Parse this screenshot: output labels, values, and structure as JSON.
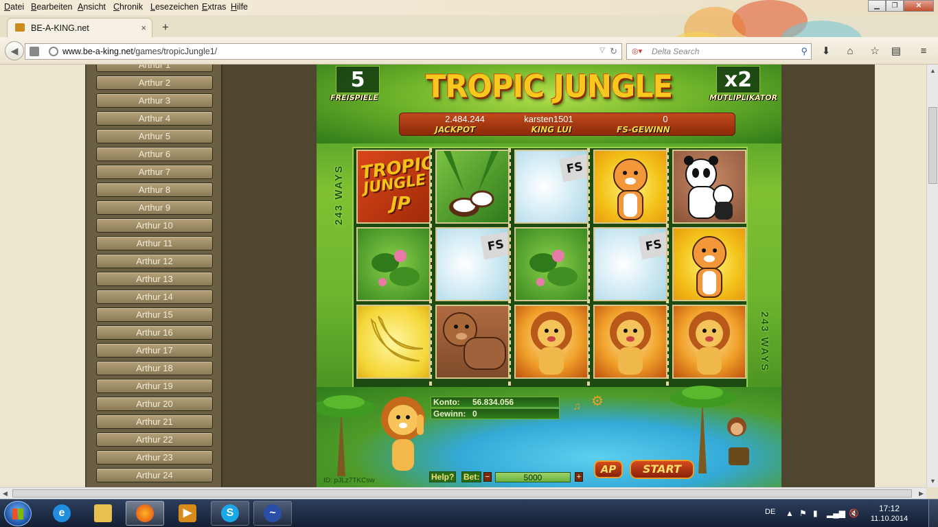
{
  "menu": [
    "Datei",
    "Bearbeiten",
    "Ansicht",
    "Chronik",
    "Lesezeichen",
    "Extras",
    "Hilfe"
  ],
  "tab": {
    "title": "BE-A-KING.net",
    "close": "×",
    "new": "+"
  },
  "address": {
    "url_host": "www.be-a-king.net",
    "url_path": "/games/tropicJungle1/"
  },
  "search": {
    "placeholder": "Delta Search"
  },
  "sidebar": {
    "items": [
      "Arthur 1",
      "Arthur 2",
      "Arthur 3",
      "Arthur 4",
      "Arthur 5",
      "Arthur 6",
      "Arthur 7",
      "Arthur 8",
      "Arthur 9",
      "Arthur 10",
      "Arthur 11",
      "Arthur 12",
      "Arthur 13",
      "Arthur 14",
      "Arthur 15",
      "Arthur 16",
      "Arthur 17",
      "Arthur 18",
      "Arthur 19",
      "Arthur 20",
      "Arthur 21",
      "Arthur 22",
      "Arthur 23",
      "Arthur 24"
    ]
  },
  "game": {
    "title": "TROPIC JUNGLE",
    "freespins_value": "5",
    "freespins_label": "FREISPIELE",
    "multiplier_value": "x2",
    "multiplier_label": "MUTLIPLIKATOR",
    "jackpot_value": "2.484.244",
    "jackpot_label": "JACKPOT",
    "king_value": "karsten1501",
    "king_label": "KING LUI",
    "fs_win_value": "0",
    "fs_win_label": "FS-GEWINN",
    "ways": "243 WAYS",
    "reels": [
      [
        "tropic-jungle-jp",
        "flower",
        "banana"
      ],
      [
        "coconut",
        "free-spin",
        "bear"
      ],
      [
        "free-spin",
        "flower",
        "lion"
      ],
      [
        "tiger",
        "free-spin",
        "lion"
      ],
      [
        "panda",
        "tiger",
        "lion"
      ]
    ],
    "jp_symbol": {
      "line1": "TROPIC",
      "line2": "JUNGLE",
      "line3": "JP"
    },
    "fs_symbol_text": "FS",
    "konto_label": "Konto:",
    "konto_value": "56.834.056",
    "gewinn_label": "Gewinn:",
    "gewinn_value": "0",
    "help_label": "Help?",
    "bet_label": "Bet:",
    "bet_minus": "−",
    "bet_plus": "+",
    "bet_value": "5000",
    "ap_label": "AP",
    "start_label": "START",
    "id_text": "ID: pJLz7TKCsw"
  },
  "taskbar": {
    "language": "DE",
    "time": "17:12",
    "date": "11.10.2014"
  },
  "colors": {
    "page_bg": "#ece6cf",
    "sidebar_button": "#a0905f",
    "game_green": "#6cb52e",
    "title_gold": "#f7c91e",
    "plank_red": "#a43510"
  }
}
